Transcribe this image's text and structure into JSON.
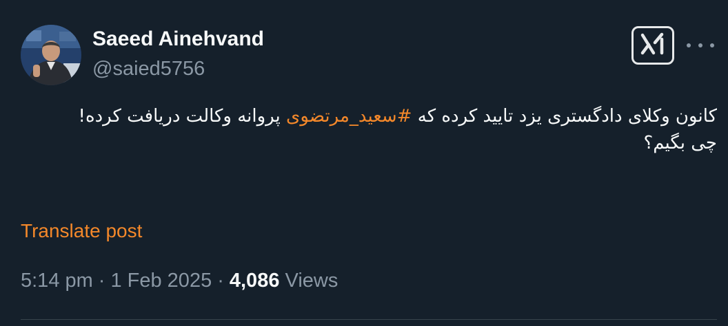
{
  "author": {
    "display_name": "Saeed Ainehvand",
    "handle": "@saied5756"
  },
  "toolbar": {
    "grok_icon": "grok-x-icon",
    "more_icon": "more-horizontal-icon"
  },
  "post": {
    "line1_before": "کانون وکلای دادگستری یزد تایید کرده که ",
    "hashtag": "#سعید_مرتضوی",
    "line1_after": " پروانه وکالت دریافت کرده!",
    "line2": "چی بگیم؟"
  },
  "translate_label": "Translate post",
  "meta": {
    "time": "5:14 pm",
    "date": "1 Feb 2025",
    "separator": "·",
    "views_count": "4,086",
    "views_label": "Views"
  },
  "colors": {
    "background": "#15202b",
    "accent": "#f4882a",
    "secondary_text": "#8b98a5"
  }
}
